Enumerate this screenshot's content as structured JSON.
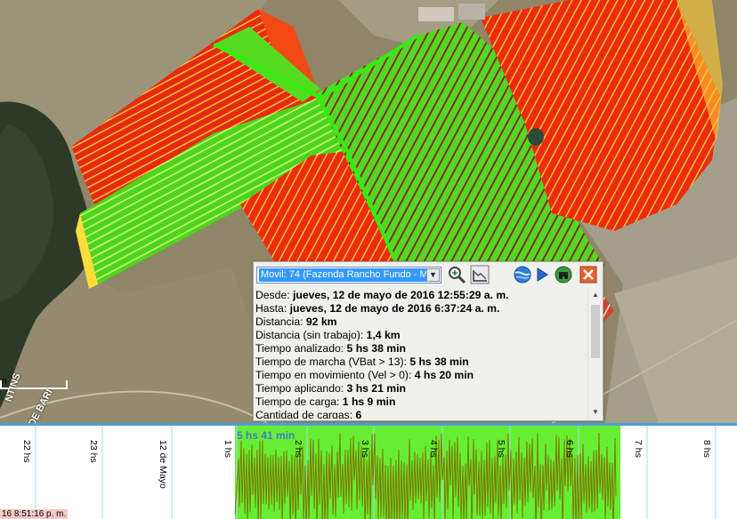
{
  "map": {
    "scale_label": "n",
    "road_label": "NTINS",
    "road_label2": "DE BARI"
  },
  "panel": {
    "vehicle_selected": "Movil: 74 (Fazenda Rancho Fundo - MSU)",
    "toolbar": [
      {
        "name": "zoom-icon"
      },
      {
        "name": "chart-icon"
      },
      {
        "name": "globe-icon"
      },
      {
        "name": "play-icon"
      },
      {
        "name": "tractor-icon"
      },
      {
        "name": "close-icon"
      }
    ],
    "stats": [
      {
        "label": "Desde:",
        "value": "jueves, 12 de mayo de 2016 12:55:29 a. m."
      },
      {
        "label": "Hasta:",
        "value": "jueves, 12 de mayo de 2016 6:37:24 a. m."
      },
      {
        "label": "Distancia:",
        "value": "92  km"
      },
      {
        "label": "Distancia (sin trabajo):",
        "value": "1,4  km"
      },
      {
        "label": "Tiempo analizado:",
        "value": "5 hs 38 min"
      },
      {
        "label": "Tiempo de marcha (VBat > 13):",
        "value": "5 hs 38 min"
      },
      {
        "label": "Tiempo en movimiento (Vel > 0):",
        "value": "4 hs 20 min"
      },
      {
        "label": "Tiempo aplicando:",
        "value": "3 hs 21 min"
      },
      {
        "label": "Tiempo de carga:",
        "value": "1 hs 9 min"
      },
      {
        "label": "Cantidad de cargas:",
        "value": "6"
      }
    ]
  },
  "timeline": {
    "labels": [
      "22 hs",
      "23 hs",
      "12 de Mayo",
      "1 hs",
      "2 hs",
      "3 hs",
      "4 hs",
      "5 hs",
      "6 hs",
      "7 hs",
      "8 hs"
    ],
    "duration": "5 hs 41 min",
    "cursor_time": "16 8:51:16 p. m.",
    "colors": {
      "active": "#66ee33",
      "trace": "#7a7a00",
      "grid": "#a8d8f0"
    }
  }
}
